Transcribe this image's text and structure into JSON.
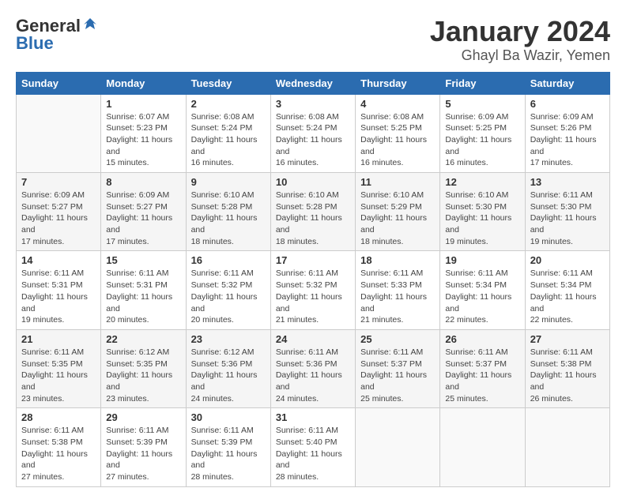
{
  "logo": {
    "general": "General",
    "blue": "Blue"
  },
  "title": "January 2024",
  "subtitle": "Ghayl Ba Wazir, Yemen",
  "days_of_week": [
    "Sunday",
    "Monday",
    "Tuesday",
    "Wednesday",
    "Thursday",
    "Friday",
    "Saturday"
  ],
  "weeks": [
    [
      {
        "day": "",
        "sunrise": "",
        "sunset": "",
        "daylight": ""
      },
      {
        "day": "1",
        "sunrise": "Sunrise: 6:07 AM",
        "sunset": "Sunset: 5:23 PM",
        "daylight": "Daylight: 11 hours and 15 minutes."
      },
      {
        "day": "2",
        "sunrise": "Sunrise: 6:08 AM",
        "sunset": "Sunset: 5:24 PM",
        "daylight": "Daylight: 11 hours and 16 minutes."
      },
      {
        "day": "3",
        "sunrise": "Sunrise: 6:08 AM",
        "sunset": "Sunset: 5:24 PM",
        "daylight": "Daylight: 11 hours and 16 minutes."
      },
      {
        "day": "4",
        "sunrise": "Sunrise: 6:08 AM",
        "sunset": "Sunset: 5:25 PM",
        "daylight": "Daylight: 11 hours and 16 minutes."
      },
      {
        "day": "5",
        "sunrise": "Sunrise: 6:09 AM",
        "sunset": "Sunset: 5:25 PM",
        "daylight": "Daylight: 11 hours and 16 minutes."
      },
      {
        "day": "6",
        "sunrise": "Sunrise: 6:09 AM",
        "sunset": "Sunset: 5:26 PM",
        "daylight": "Daylight: 11 hours and 17 minutes."
      }
    ],
    [
      {
        "day": "7",
        "sunrise": "Sunrise: 6:09 AM",
        "sunset": "Sunset: 5:27 PM",
        "daylight": "Daylight: 11 hours and 17 minutes."
      },
      {
        "day": "8",
        "sunrise": "Sunrise: 6:09 AM",
        "sunset": "Sunset: 5:27 PM",
        "daylight": "Daylight: 11 hours and 17 minutes."
      },
      {
        "day": "9",
        "sunrise": "Sunrise: 6:10 AM",
        "sunset": "Sunset: 5:28 PM",
        "daylight": "Daylight: 11 hours and 18 minutes."
      },
      {
        "day": "10",
        "sunrise": "Sunrise: 6:10 AM",
        "sunset": "Sunset: 5:28 PM",
        "daylight": "Daylight: 11 hours and 18 minutes."
      },
      {
        "day": "11",
        "sunrise": "Sunrise: 6:10 AM",
        "sunset": "Sunset: 5:29 PM",
        "daylight": "Daylight: 11 hours and 18 minutes."
      },
      {
        "day": "12",
        "sunrise": "Sunrise: 6:10 AM",
        "sunset": "Sunset: 5:30 PM",
        "daylight": "Daylight: 11 hours and 19 minutes."
      },
      {
        "day": "13",
        "sunrise": "Sunrise: 6:11 AM",
        "sunset": "Sunset: 5:30 PM",
        "daylight": "Daylight: 11 hours and 19 minutes."
      }
    ],
    [
      {
        "day": "14",
        "sunrise": "Sunrise: 6:11 AM",
        "sunset": "Sunset: 5:31 PM",
        "daylight": "Daylight: 11 hours and 19 minutes."
      },
      {
        "day": "15",
        "sunrise": "Sunrise: 6:11 AM",
        "sunset": "Sunset: 5:31 PM",
        "daylight": "Daylight: 11 hours and 20 minutes."
      },
      {
        "day": "16",
        "sunrise": "Sunrise: 6:11 AM",
        "sunset": "Sunset: 5:32 PM",
        "daylight": "Daylight: 11 hours and 20 minutes."
      },
      {
        "day": "17",
        "sunrise": "Sunrise: 6:11 AM",
        "sunset": "Sunset: 5:32 PM",
        "daylight": "Daylight: 11 hours and 21 minutes."
      },
      {
        "day": "18",
        "sunrise": "Sunrise: 6:11 AM",
        "sunset": "Sunset: 5:33 PM",
        "daylight": "Daylight: 11 hours and 21 minutes."
      },
      {
        "day": "19",
        "sunrise": "Sunrise: 6:11 AM",
        "sunset": "Sunset: 5:34 PM",
        "daylight": "Daylight: 11 hours and 22 minutes."
      },
      {
        "day": "20",
        "sunrise": "Sunrise: 6:11 AM",
        "sunset": "Sunset: 5:34 PM",
        "daylight": "Daylight: 11 hours and 22 minutes."
      }
    ],
    [
      {
        "day": "21",
        "sunrise": "Sunrise: 6:11 AM",
        "sunset": "Sunset: 5:35 PM",
        "daylight": "Daylight: 11 hours and 23 minutes."
      },
      {
        "day": "22",
        "sunrise": "Sunrise: 6:12 AM",
        "sunset": "Sunset: 5:35 PM",
        "daylight": "Daylight: 11 hours and 23 minutes."
      },
      {
        "day": "23",
        "sunrise": "Sunrise: 6:12 AM",
        "sunset": "Sunset: 5:36 PM",
        "daylight": "Daylight: 11 hours and 24 minutes."
      },
      {
        "day": "24",
        "sunrise": "Sunrise: 6:11 AM",
        "sunset": "Sunset: 5:36 PM",
        "daylight": "Daylight: 11 hours and 24 minutes."
      },
      {
        "day": "25",
        "sunrise": "Sunrise: 6:11 AM",
        "sunset": "Sunset: 5:37 PM",
        "daylight": "Daylight: 11 hours and 25 minutes."
      },
      {
        "day": "26",
        "sunrise": "Sunrise: 6:11 AM",
        "sunset": "Sunset: 5:37 PM",
        "daylight": "Daylight: 11 hours and 25 minutes."
      },
      {
        "day": "27",
        "sunrise": "Sunrise: 6:11 AM",
        "sunset": "Sunset: 5:38 PM",
        "daylight": "Daylight: 11 hours and 26 minutes."
      }
    ],
    [
      {
        "day": "28",
        "sunrise": "Sunrise: 6:11 AM",
        "sunset": "Sunset: 5:38 PM",
        "daylight": "Daylight: 11 hours and 27 minutes."
      },
      {
        "day": "29",
        "sunrise": "Sunrise: 6:11 AM",
        "sunset": "Sunset: 5:39 PM",
        "daylight": "Daylight: 11 hours and 27 minutes."
      },
      {
        "day": "30",
        "sunrise": "Sunrise: 6:11 AM",
        "sunset": "Sunset: 5:39 PM",
        "daylight": "Daylight: 11 hours and 28 minutes."
      },
      {
        "day": "31",
        "sunrise": "Sunrise: 6:11 AM",
        "sunset": "Sunset: 5:40 PM",
        "daylight": "Daylight: 11 hours and 28 minutes."
      },
      {
        "day": "",
        "sunrise": "",
        "sunset": "",
        "daylight": ""
      },
      {
        "day": "",
        "sunrise": "",
        "sunset": "",
        "daylight": ""
      },
      {
        "day": "",
        "sunrise": "",
        "sunset": "",
        "daylight": ""
      }
    ]
  ]
}
